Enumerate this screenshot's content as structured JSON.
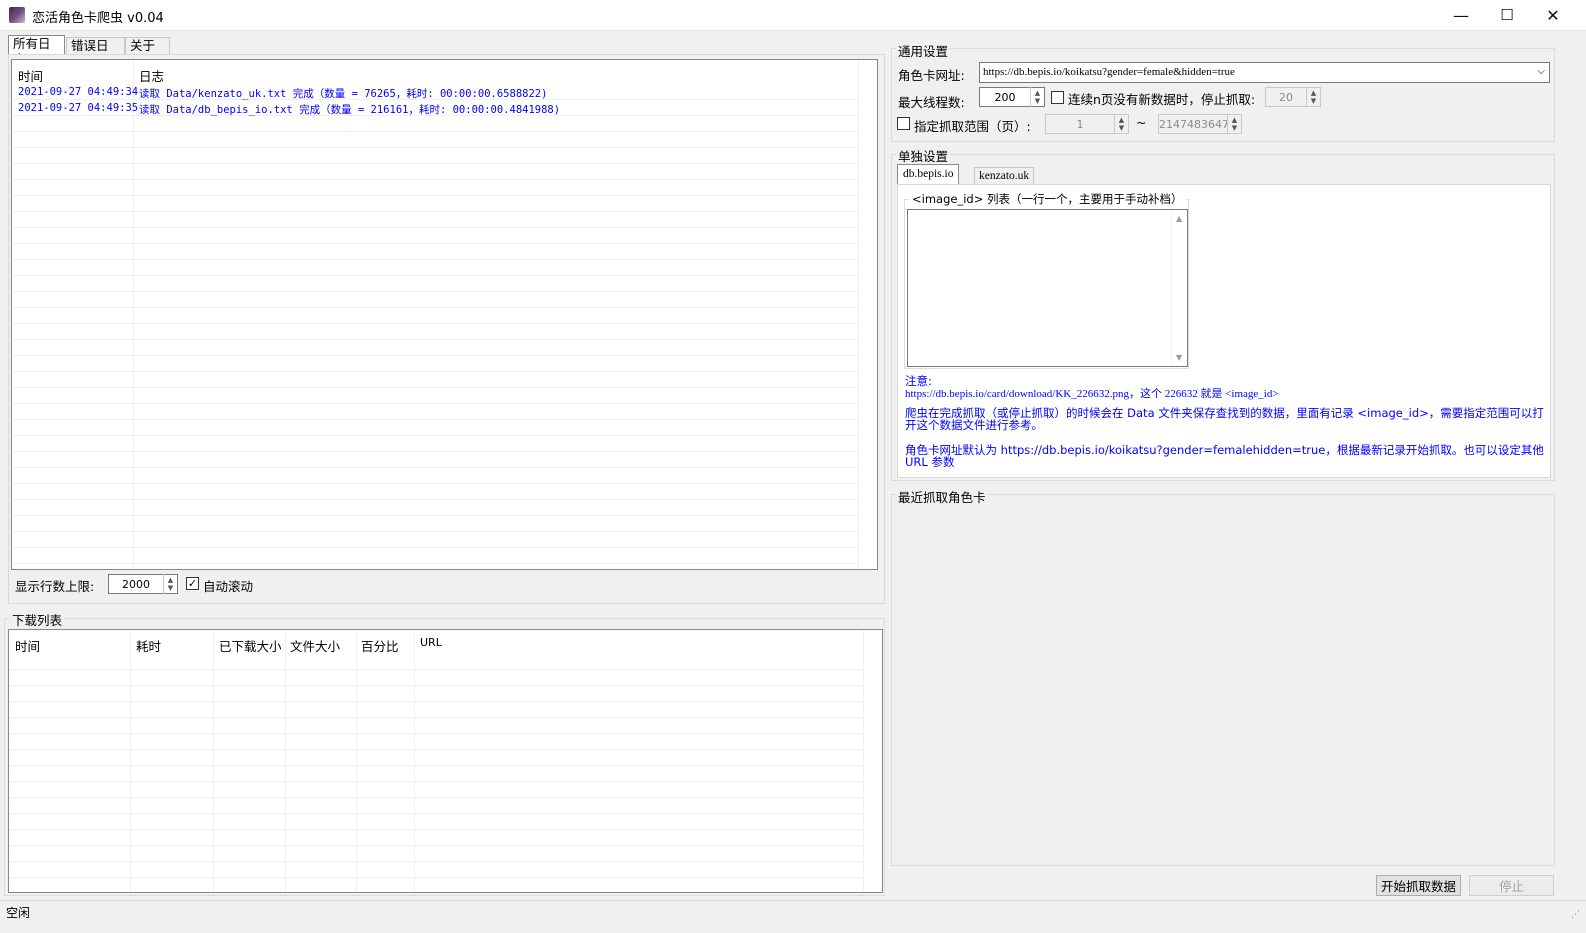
{
  "window": {
    "title": "恋活角色卡爬虫 v0.04",
    "minimize_glyph": "—",
    "maximize_glyph": "☐",
    "close_glyph": "✕"
  },
  "log_tabs": [
    "所有日志",
    "错误日志",
    "关于"
  ],
  "log_list": {
    "columns": [
      "时间",
      "日志"
    ],
    "rows": [
      {
        "time": "2021-09-27 04:49:34",
        "message": "读取 Data/kenzato_uk.txt 完成（数量 = 76265，耗时: 00:00:00.6588822)"
      },
      {
        "time": "2021-09-27 04:49:35",
        "message": "读取 Data/db_bepis_io.txt 完成（数量 = 216161，耗时: 00:00:00.4841988)"
      }
    ]
  },
  "log_options": {
    "max_rows_label": "显示行数上限:",
    "max_rows_value": "2000",
    "auto_scroll_label": "自动滚动",
    "auto_scroll_checked": true
  },
  "download_list": {
    "title": "下载列表",
    "columns": [
      "时间",
      "耗时",
      "已下载大小",
      "文件大小",
      "百分比",
      "URL"
    ]
  },
  "general_settings": {
    "title": "通用设置",
    "url_label": "角色卡网址:",
    "url_value": "https://db.bepis.io/koikatsu?gender=female&hidden=true",
    "threads_label": "最大线程数:",
    "threads_value": "200",
    "stop_label": "连续n页没有新数据时，停止抓取:",
    "stop_value": "20",
    "range_label": "指定抓取范围（页）:",
    "range_from": "1",
    "range_sep": "~",
    "range_to": "2147483647"
  },
  "single_settings": {
    "title": "单独设置",
    "tabs": [
      "db.bepis.io",
      "kenzato.uk"
    ],
    "image_id_group": "<image_id> 列表（一行一个，主要用于手动补档）",
    "note_title": "注意:",
    "note_line1": "https://db.bepis.io/card/download/KK_226632.png，这个 226632 就是 <image_id>",
    "note_para2": "爬虫在完成抓取（或停止抓取）的时候会在 Data 文件夹保存查找到的数据，里面有记录 <image_id>，需要指定范围可以打开这个数据文件进行参考。",
    "note_para3": "角色卡网址默认为 https://db.bepis.io/koikatsu?gender=femalehidden=true，根据最新记录开始抓取。也可以设定其他 URL 参数"
  },
  "recent": {
    "title": "最近抓取角色卡"
  },
  "actions": {
    "start": "开始抓取数据",
    "stop": "停止"
  },
  "status": {
    "text": "空闲"
  }
}
